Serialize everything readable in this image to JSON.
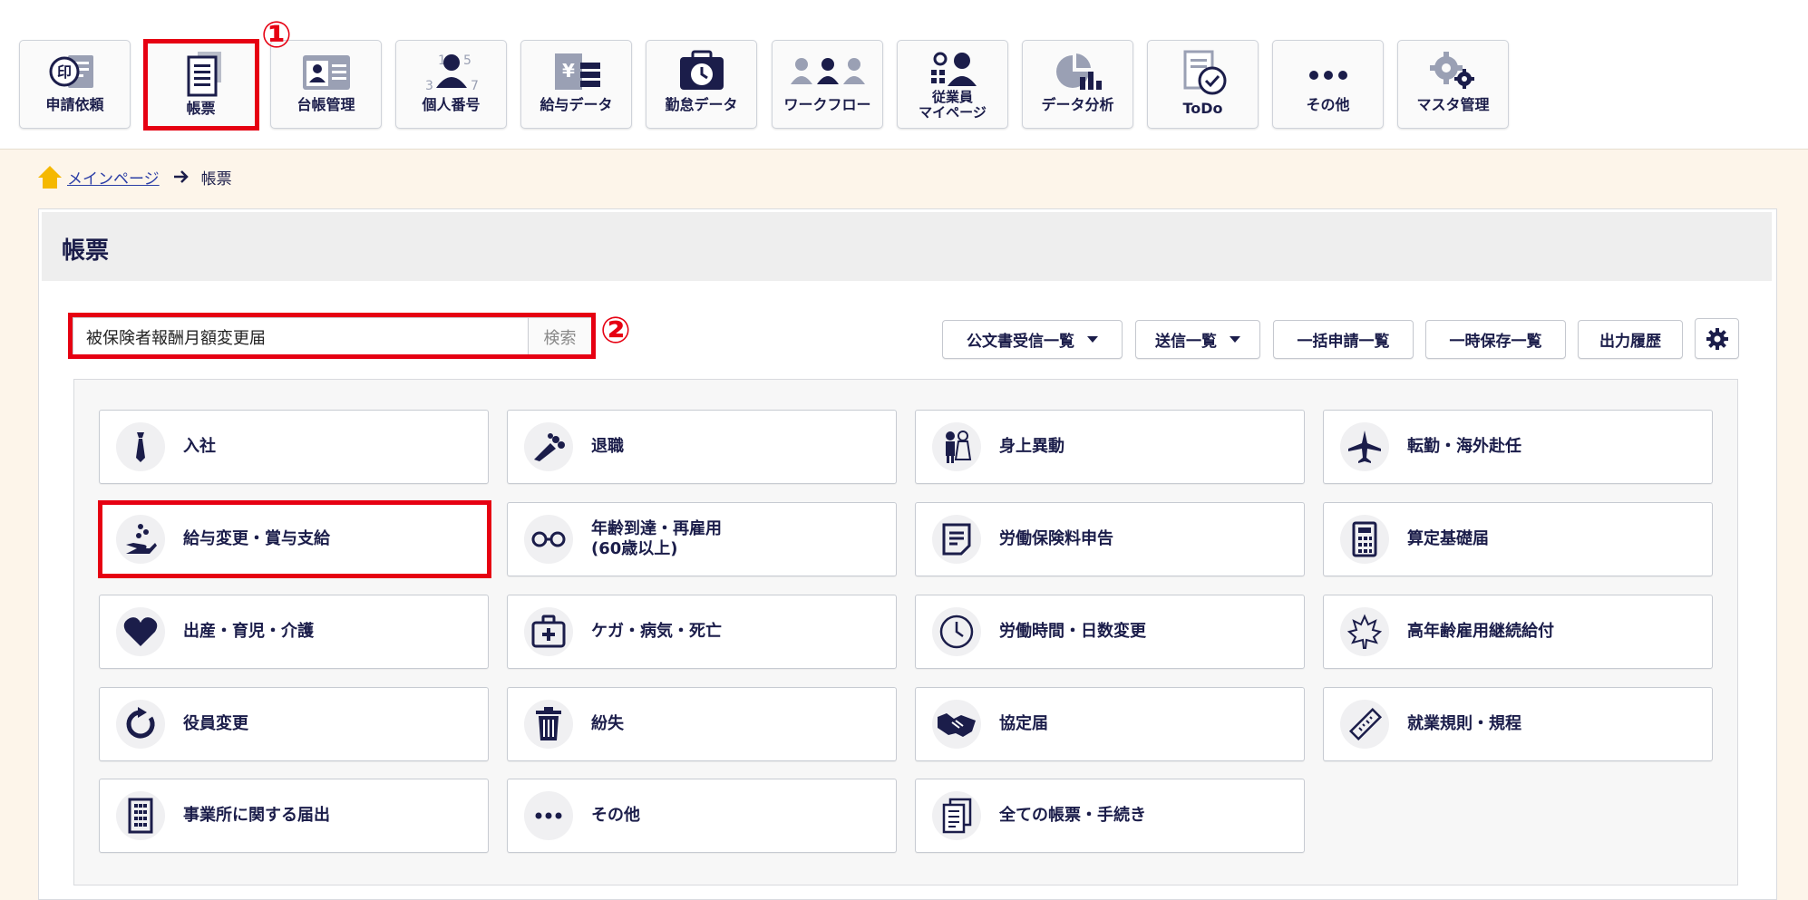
{
  "nav": {
    "items": [
      {
        "label": "申請依頼",
        "icon": "stamp-icon"
      },
      {
        "label": "帳票",
        "icon": "document-icon"
      },
      {
        "label": "台帳管理",
        "icon": "ledger-icon"
      },
      {
        "label": "個人番号",
        "icon": "person-number-icon"
      },
      {
        "label": "給与データ",
        "icon": "salary-data-icon"
      },
      {
        "label": "勤怠データ",
        "icon": "attendance-icon"
      },
      {
        "label": "ワークフロー",
        "icon": "workflow-icon"
      },
      {
        "label": "従業員\nマイページ",
        "icon": "employee-icon"
      },
      {
        "label": "データ分析",
        "icon": "chart-icon"
      },
      {
        "label": "ToDo",
        "icon": "todo-icon"
      },
      {
        "label": "その他",
        "icon": "more-icon"
      },
      {
        "label": "マスタ管理",
        "icon": "gear-icon"
      }
    ]
  },
  "annotations": {
    "one": "①",
    "two": "②"
  },
  "breadcrumb": {
    "home": "メインページ",
    "current": "帳票"
  },
  "page": {
    "title": "帳票"
  },
  "search": {
    "value": "被保険者報酬月額変更届",
    "button": "検索"
  },
  "toolbar": {
    "public_docs": "公文書受信一覧",
    "sent": "送信一覧",
    "bulk": "一括申請一覧",
    "temp": "一時保存一覧",
    "history": "出力履歴"
  },
  "categories": [
    {
      "label": "入社",
      "icon": "tie-icon"
    },
    {
      "label": "退職",
      "icon": "bouquet-icon"
    },
    {
      "label": "身上異動",
      "icon": "couple-icon"
    },
    {
      "label": "転勤・海外赴任",
      "icon": "airplane-icon"
    },
    {
      "label": "給与変更・賞与支給",
      "icon": "hand-coins-icon"
    },
    {
      "label": "年齢到達・再雇用\n(60歳以上)",
      "icon": "glasses-icon"
    },
    {
      "label": "労働保険料申告",
      "icon": "form-icon"
    },
    {
      "label": "算定基礎届",
      "icon": "calculator-icon"
    },
    {
      "label": "出産・育児・介護",
      "icon": "heart-icon"
    },
    {
      "label": "ケガ・病気・死亡",
      "icon": "first-aid-icon"
    },
    {
      "label": "労働時間・日数変更",
      "icon": "clock-icon"
    },
    {
      "label": "高年齢雇用継続給付",
      "icon": "maple-leaf-icon"
    },
    {
      "label": "役員変更",
      "icon": "refresh-icon"
    },
    {
      "label": "紛失",
      "icon": "trash-icon"
    },
    {
      "label": "協定届",
      "icon": "handshake-icon"
    },
    {
      "label": "就業規則・規程",
      "icon": "ruler-icon"
    },
    {
      "label": "事業所に関する届出",
      "icon": "building-icon"
    },
    {
      "label": "その他",
      "icon": "ellipsis-icon"
    },
    {
      "label": "全ての帳票・手続き",
      "icon": "documents-icon"
    }
  ]
}
